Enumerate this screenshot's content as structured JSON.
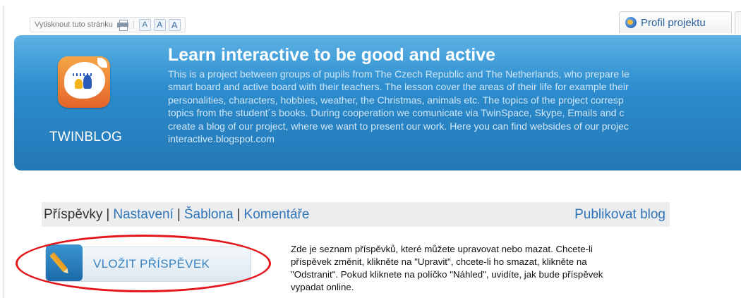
{
  "toolbar": {
    "print_label": "Vytisknout tuto stránku",
    "font_buttons": [
      "A",
      "A",
      "A"
    ]
  },
  "profile_tab": {
    "label": "Profil projektu"
  },
  "banner": {
    "logo_label": "TWINBLOG",
    "title": "Learn interactive to be good and active",
    "description_lines": [
      "This is a project between groups of pupils from The Czech Republic and The Netherlands, who prepare le",
      "smart board and active board with their teachers. The lesson cover the areas of their life for example their",
      "personalities, characters, hobbies, weather, the Christmas, animals etc. The topics of the project corresp",
      "topics from the student´s books. During cooperation we comunicate via TwinSpace, Skype, Emails and c",
      "create a blog of our project, where we want to present our work. Here you can find websides of our projec",
      "interactive.blogspot.com"
    ]
  },
  "nav": {
    "current": "Příspěvky",
    "separator": "|",
    "links": [
      "Nastavení",
      "Šablona",
      "Komentáře"
    ],
    "publish": "Publikovat blog"
  },
  "add_post_button": {
    "label": "VLOŽIT PŘÍSPĚVEK"
  },
  "help_text_lines": [
    "Zde je seznam příspěvků, které můžete upravovat nebo mazat. Chcete-li",
    "příspěvek změnit, klikněte na \"Upravit\", chcete-li ho smazat, klikněte na",
    "\"Odstranit\". Pokud kliknete na políčko \"Náhled\", uvidíte, jak bude příspěvek",
    "vypadat online."
  ],
  "colors": {
    "banner": "#2b8acb",
    "link": "#2f74b8",
    "highlight_ellipse": "#e3161b",
    "logo_orange": "#e3642a"
  }
}
